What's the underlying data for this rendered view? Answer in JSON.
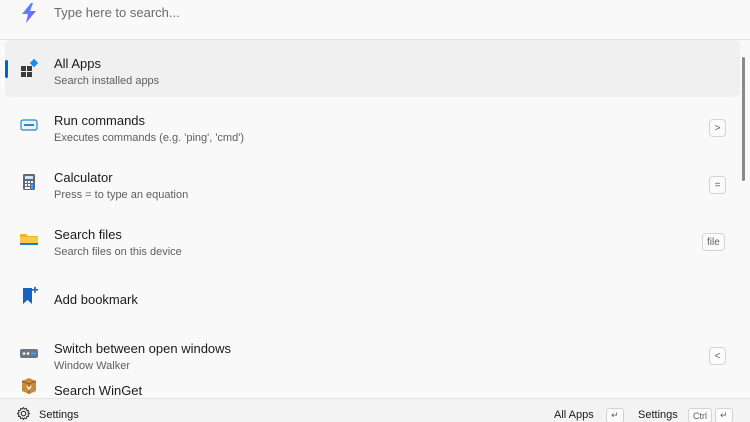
{
  "search": {
    "placeholder": "Type here to search..."
  },
  "results": [
    {
      "title": "All Apps",
      "subtitle": "Search installed apps",
      "shortcut": "",
      "icon": "all-apps-icon",
      "selected": true
    },
    {
      "title": "Run commands",
      "subtitle": "Executes commands (e.g. 'ping', 'cmd')",
      "shortcut": ">",
      "icon": "terminal-icon"
    },
    {
      "title": "Calculator",
      "subtitle": "Press = to type an equation",
      "shortcut": "=",
      "icon": "calculator-icon"
    },
    {
      "title": "Search files",
      "subtitle": "Search files on this device",
      "shortcut": "file",
      "icon": "folder-icon"
    },
    {
      "title": "Add bookmark",
      "subtitle": "",
      "shortcut": "",
      "icon": "bookmark-add-icon"
    },
    {
      "title": "Switch between open windows",
      "subtitle": "Window Walker",
      "shortcut": "<",
      "icon": "window-switch-icon"
    },
    {
      "title": "Search WinGet",
      "subtitle": "",
      "shortcut": "",
      "icon": "winget-package-icon"
    }
  ],
  "footer": {
    "settings_label": "Settings",
    "primary_action": "All Apps",
    "primary_key": "↵",
    "secondary_action": "Settings",
    "secondary_modifier": "Ctrl",
    "secondary_key": "↵"
  },
  "colors": {
    "accent": "#0067c0",
    "logo": "#6a5cf0"
  }
}
